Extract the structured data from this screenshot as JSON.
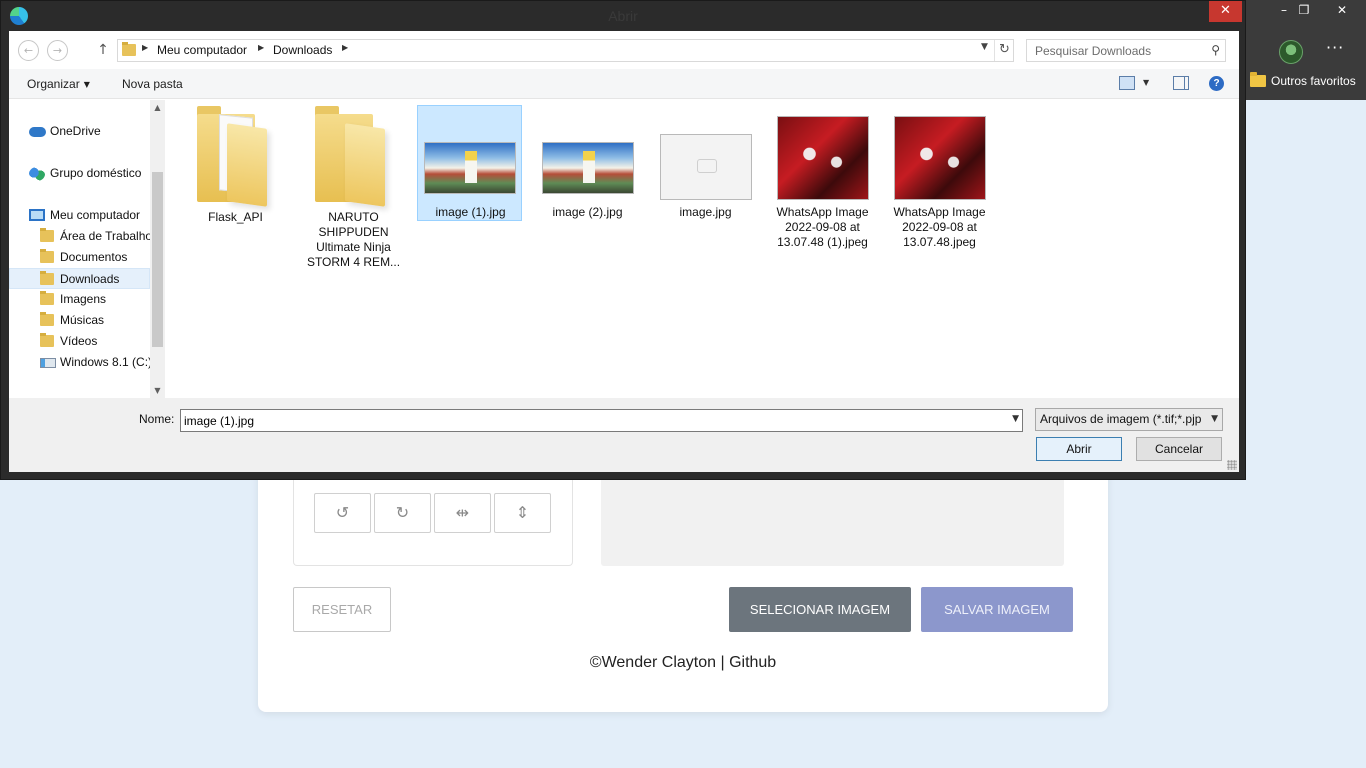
{
  "browser": {
    "favorites_folder": "Outros favoritos"
  },
  "webapp": {
    "reset_label": "RESETAR",
    "select_label": "SELECIONAR IMAGEM",
    "save_label": "SALVAR IMAGEM",
    "footer": "©Wender Clayton | Github",
    "colors": {
      "select_bg": "#6c757d",
      "save_bg": "#8c97cc",
      "page_bg": "#e3eef9"
    }
  },
  "dialog": {
    "title": "Abrir",
    "breadcrumb": [
      "Meu computador",
      "Downloads"
    ],
    "search_placeholder": "Pesquisar Downloads",
    "toolbar": {
      "organize": "Organizar",
      "new_folder": "Nova pasta"
    },
    "nav_items": [
      {
        "label": "OneDrive",
        "icon": "cloud-icon"
      },
      {
        "label": "Grupo doméstico",
        "icon": "homegroup-icon"
      },
      {
        "label": "Meu computador",
        "icon": "computer-icon"
      },
      {
        "label": "Área de Trabalho",
        "icon": "folder-icon"
      },
      {
        "label": "Documentos",
        "icon": "folder-icon"
      },
      {
        "label": "Downloads",
        "icon": "folder-icon",
        "selected": true
      },
      {
        "label": "Imagens",
        "icon": "folder-icon"
      },
      {
        "label": "Músicas",
        "icon": "folder-icon"
      },
      {
        "label": "Vídeos",
        "icon": "folder-icon"
      },
      {
        "label": "Windows 8.1 (C:)",
        "icon": "drive-icon"
      }
    ],
    "files": [
      {
        "name": "Flask_API",
        "kind": "folder"
      },
      {
        "name": "NARUTO SHIPPUDEN Ultimate Ninja STORM 4 REM...",
        "kind": "folder"
      },
      {
        "name": "image (1).jpg",
        "kind": "image",
        "selected": true
      },
      {
        "name": "image (2).jpg",
        "kind": "image"
      },
      {
        "name": "image.jpg",
        "kind": "image"
      },
      {
        "name": "WhatsApp Image 2022-09-08 at 13.07.48 (1).jpeg",
        "kind": "image"
      },
      {
        "name": "WhatsApp Image 2022-09-08 at 13.07.48.jpeg",
        "kind": "image"
      }
    ],
    "name_label": "Nome:",
    "name_value": "image (1).jpg",
    "file_type": "Arquivos de imagem (*.tif;*.pjp",
    "open_label": "Abrir",
    "cancel_label": "Cancelar",
    "colors": {
      "selection": "#cce8ff",
      "close_button": "#c7372f"
    }
  }
}
